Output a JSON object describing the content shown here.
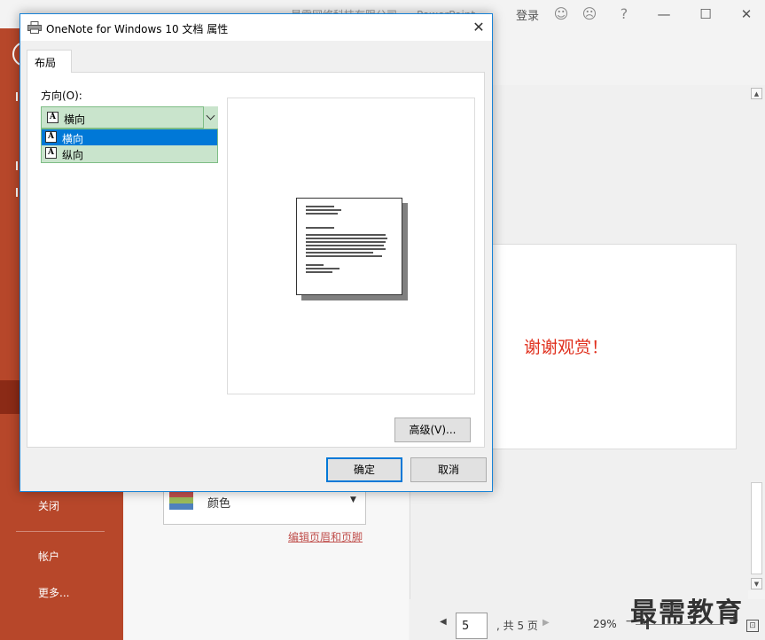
{
  "app": {
    "window_title_left": "最需网络科技有限公司",
    "window_title_right": "PowerPoint",
    "login_label": "登录",
    "help_label": "?"
  },
  "backstage": {
    "items": [
      {
        "label": "关闭"
      },
      {
        "label": "帐户"
      },
      {
        "label": "更多..."
      }
    ]
  },
  "settings": {
    "color_label": "颜色",
    "edit_header_footer_link": "编辑页眉和页脚"
  },
  "slide": {
    "text": "谢谢观赏！"
  },
  "statusbar": {
    "page_number": "5",
    "page_total": ", 共 5 页",
    "zoom": "29%"
  },
  "watermark": "最需教育",
  "dialog": {
    "title": "OneNote for Windows 10 文档 属性",
    "tab_label": "布局",
    "orientation_label": "方向(O):",
    "orientation_selected": "横向",
    "orientation_options": [
      {
        "label": "横向",
        "selected": true
      },
      {
        "label": "纵向",
        "selected": false
      }
    ],
    "advanced_button": "高级(V)...",
    "ok_button": "确定",
    "cancel_button": "取消"
  },
  "colors": {
    "accent_backstage": "#b7472a",
    "selection_blue": "#0078d7",
    "combo_green": "#c9e4cc",
    "slide_text_red": "#e0301e"
  }
}
